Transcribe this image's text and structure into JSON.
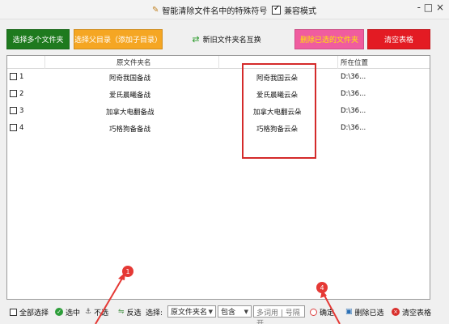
{
  "titlebar": {
    "title": "智能清除文件名中的特殊符号",
    "compat_label": "兼容模式",
    "window_controls": "- □ ×"
  },
  "toolbar": {
    "select_files": "选择多个文件夹",
    "select_parent": "选择父目录（添加子目录）",
    "swap_names": "新旧文件夹名互换",
    "delete_selected": "删除已选的文件夹",
    "clear_table": "清空表格"
  },
  "table": {
    "headers": {
      "original": "原文件夹名",
      "location": "所在位置"
    },
    "rows": [
      {
        "index": "1",
        "original": "阿奇我国备战",
        "new": "阿奇我国云朵",
        "location": "D:\\36..."
      },
      {
        "index": "2",
        "original": "爱氏晨曦备战",
        "new": "爱氏晨曦云朵",
        "location": "D:\\36..."
      },
      {
        "index": "3",
        "original": "加拿大电翻备战",
        "new": "加拿大电翻云朵",
        "location": "D:\\36..."
      },
      {
        "index": "4",
        "original": "巧格狗备备战",
        "new": "巧格狗备云朵",
        "location": "D:\\36..."
      }
    ]
  },
  "bottom": {
    "select_all": "全部选择",
    "check": "选中",
    "uncheck": "不选",
    "invert": "反选",
    "filter_label": "选择:",
    "filter_field": "原文件夹名",
    "filter_op": "包含",
    "filter_placeholder": "多词用 | 号隔开",
    "confirm": "确定",
    "delete_checked": "删除已选",
    "clear_table": "清空表格"
  },
  "annotations": {
    "badge1": "1",
    "badge4": "4"
  },
  "colors": {
    "green": "#1e7a1e",
    "orange": "#f5a623",
    "pink": "#f05c9f",
    "red": "#e31b23",
    "highlight": "#d42a2a"
  }
}
